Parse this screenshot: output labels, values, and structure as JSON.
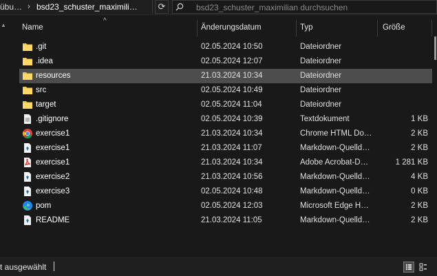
{
  "addressbar": {
    "prefix": "übu…",
    "separator": "›",
    "current": "bsd23_schuster_maximili…",
    "refresh_glyph": "⟳"
  },
  "search": {
    "placeholder": "bsd23_schuster_maximilian durchsuchen"
  },
  "columns": {
    "name": "Name",
    "date": "Änderungsdatum",
    "type": "Typ",
    "size": "Größe",
    "sort_glyph": "^"
  },
  "files": [
    {
      "name": ".git",
      "date": "02.05.2024 10:50",
      "type": "Dateiordner",
      "size": "",
      "icon": "folder-icon"
    },
    {
      "name": ".idea",
      "date": "02.05.2024 12:07",
      "type": "Dateiordner",
      "size": "",
      "icon": "folder-icon"
    },
    {
      "name": "resources",
      "date": "21.03.2024 10:34",
      "type": "Dateiordner",
      "size": "",
      "icon": "folder-icon",
      "selected": true
    },
    {
      "name": "src",
      "date": "02.05.2024 10:49",
      "type": "Dateiordner",
      "size": "",
      "icon": "folder-icon"
    },
    {
      "name": "target",
      "date": "02.05.2024 11:04",
      "type": "Dateiordner",
      "size": "",
      "icon": "folder-icon"
    },
    {
      "name": ".gitignore",
      "date": "02.05.2024 10:39",
      "type": "Textdokument",
      "size": "1 KB",
      "icon": "text-file-icon"
    },
    {
      "name": "exercise1",
      "date": "21.03.2024 10:34",
      "type": "Chrome HTML Do…",
      "size": "2 KB",
      "icon": "chrome-icon"
    },
    {
      "name": "exercise1",
      "date": "21.03.2024 11:07",
      "type": "Markdown-Quelld…",
      "size": "2 KB",
      "icon": "markdown-file-icon"
    },
    {
      "name": "exercise1",
      "date": "21.03.2024 10:34",
      "type": "Adobe Acrobat-D…",
      "size": "1 281 KB",
      "icon": "pdf-icon"
    },
    {
      "name": "exercise2",
      "date": "21.03.2024 10:56",
      "type": "Markdown-Quelld…",
      "size": "4 KB",
      "icon": "markdown-file-icon"
    },
    {
      "name": "exercise3",
      "date": "02.05.2024 10:48",
      "type": "Markdown-Quelld…",
      "size": "0 KB",
      "icon": "markdown-file-icon"
    },
    {
      "name": "pom",
      "date": "02.05.2024 12:03",
      "type": "Microsoft Edge H…",
      "size": "2 KB",
      "icon": "edge-icon"
    },
    {
      "name": "README",
      "date": "21.03.2024 11:05",
      "type": "Markdown-Quelld…",
      "size": "2 KB",
      "icon": "markdown-file-icon"
    }
  ],
  "statusbar": {
    "text": "t ausgewählt"
  },
  "colors": {
    "background": "#191919",
    "selected_row": "#4d4d4d",
    "folder": "#f2c94c",
    "chrome_red": "#db4437",
    "chrome_green": "#0f9d58",
    "chrome_yellow": "#f4b400",
    "chrome_blue": "#4285f4",
    "edge_blue": "#1e88e5",
    "edge_green": "#3ec16b",
    "pdf_red": "#e02424"
  }
}
